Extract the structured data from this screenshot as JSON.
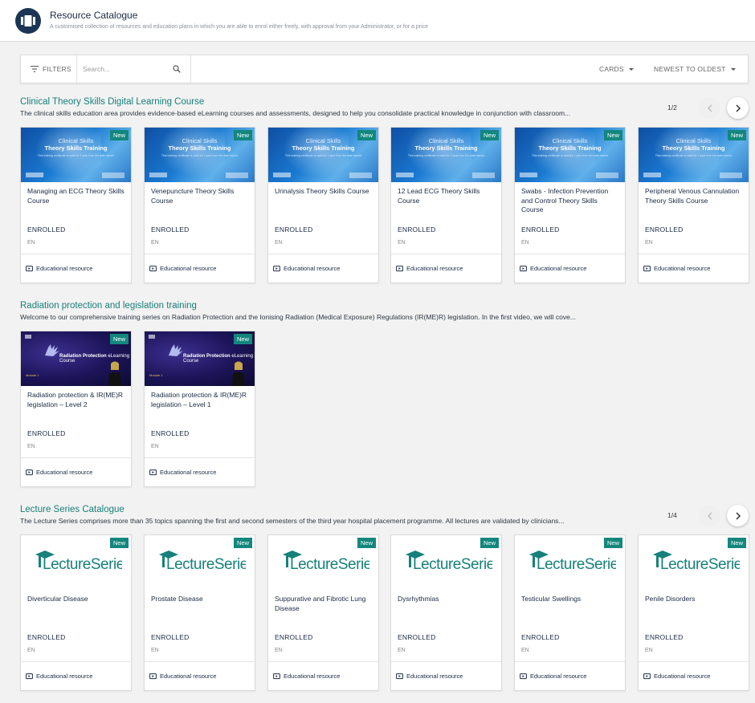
{
  "header": {
    "title": "Resource Catalogue",
    "subtitle": "A customised collection of resources and education plans in which you are able to enrol either freely, with approval from your Administrator, or for a price",
    "icon": "catalogue-icon"
  },
  "toolbar": {
    "filters_label": "FILTERS",
    "search_placeholder": "Search...",
    "view_label": "CARDS",
    "sort_label": "NEWEST TO OLDEST"
  },
  "colors": {
    "accent": "#17807a",
    "badge": "#13877d",
    "header_icon_bg": "#1b3655"
  },
  "sections": [
    {
      "title": "Clinical Theory Skills Digital Learning Course",
      "description": "The clinical skills education area provides evidence-based eLearning courses and assessments, designed to help you consolidate practical knowledge in conjunction with classroom...",
      "pager": "1/2",
      "thumbnail": {
        "line1": "Clinical Skills",
        "line2": "Theory Skills Training",
        "line3": "This training certificate is valid for 1 year from the date issued"
      },
      "cards": [
        {
          "badge": "New",
          "title": "Managing an ECG Theory Skills Course",
          "status": "ENROLLED",
          "lang": "EN",
          "type": "Educational resource"
        },
        {
          "badge": "New",
          "title": "Venepuncture Theory Skills Course",
          "status": "ENROLLED",
          "lang": "EN",
          "type": "Educational resource"
        },
        {
          "badge": "New",
          "title": "Urinalysis Theory Skills Course",
          "status": "ENROLLED",
          "lang": "EN",
          "type": "Educational resource"
        },
        {
          "badge": "New",
          "title": "12 Lead ECG Theory Skills Course",
          "status": "ENROLLED",
          "lang": "EN",
          "type": "Educational resource"
        },
        {
          "badge": "New",
          "title": "Swabs - Infection Prevention and Control Theory Skills Course",
          "status": "ENROLLED",
          "lang": "EN",
          "type": "Educational resource"
        },
        {
          "badge": "New",
          "title": "Peripheral Venous Cannulation Theory Skills Course",
          "status": "ENROLLED",
          "lang": "EN",
          "type": "Educational resource"
        }
      ]
    },
    {
      "title": "Radiation protection and legislation training",
      "description": "Welcome to our comprehensive training series on Radiation Protection and the Ionising Radiation (Medical Exposure) Regulations (IR(ME)R) legislation. In the first video, we will cove...",
      "thumbnail": {
        "title_bold": "Radiation Protection",
        "title_rest": " eLearning Course",
        "module": "Module 1"
      },
      "cards": [
        {
          "badge": "New",
          "title": "Radiation protection & IR(ME)R legislation – Level 2",
          "status": "ENROLLED",
          "lang": "EN",
          "type": "Educational resource"
        },
        {
          "badge": "New",
          "title": "Radiation protection & IR(ME)R legislation – Level 1",
          "status": "ENROLLED",
          "lang": "EN",
          "type": "Educational resource"
        }
      ]
    },
    {
      "title": "Lecture Series Catalogue",
      "description": "The Lecture Series comprises more than 35 topics spanning the first and second semesters of the third year hospital placement programme. All lectures are validated by clinicians...",
      "pager": "1/4",
      "thumbnail": {
        "logo_text": "LectureSeries"
      },
      "cards": [
        {
          "badge": "New",
          "title": "Diverticular Disease",
          "status": "ENROLLED",
          "lang": "EN",
          "type": "Educational resource"
        },
        {
          "badge": "New",
          "title": "Prostate Disease",
          "status": "ENROLLED",
          "lang": "EN",
          "type": "Educational resource"
        },
        {
          "badge": "New",
          "title": "Suppurative and Fibrotic Lung Disease",
          "status": "ENROLLED",
          "lang": "EN",
          "type": "Educational resource"
        },
        {
          "badge": "New",
          "title": "Dysrhythmias",
          "status": "ENROLLED",
          "lang": "EN",
          "type": "Educational resource"
        },
        {
          "badge": "New",
          "title": "Testicular Swellings",
          "status": "ENROLLED",
          "lang": "EN",
          "type": "Educational resource"
        },
        {
          "badge": "New",
          "title": "Penile Disorders",
          "status": "ENROLLED",
          "lang": "EN",
          "type": "Educational resource"
        }
      ]
    }
  ]
}
